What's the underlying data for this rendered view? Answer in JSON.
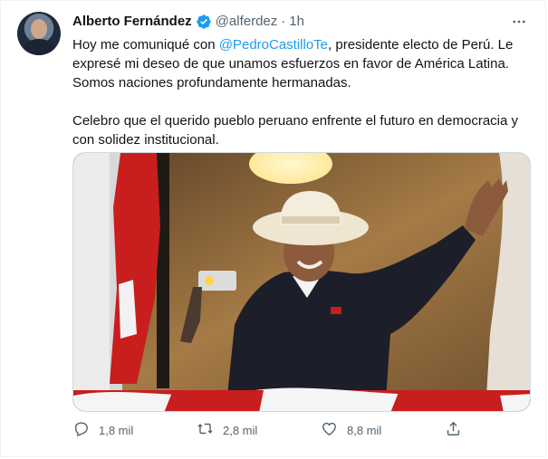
{
  "tweet": {
    "author_name": "Alberto Fernández",
    "author_handle": "@alferdez",
    "separator": "·",
    "time": "1h",
    "text_p1_before": "Hoy me comuniqué con ",
    "mention": "@PedroCastilloTe",
    "text_p1_after": ", presidente electo de Perú. Le expresé mi deseo de que unamos esfuerzos en favor de América Latina. Somos naciones profundamente hermanadas.",
    "text_p2": "Celebro que el querido pueblo peruano enfrente el futuro en democracia y con solidez institucional."
  },
  "actions": {
    "reply_count": "1,8 mil",
    "retweet_count": "2,8 mil",
    "like_count": "8,8 mil"
  },
  "icons": {
    "verified": "verified-badge-icon",
    "more": "more-icon",
    "reply": "reply-icon",
    "retweet": "retweet-icon",
    "like": "like-icon",
    "share": "share-icon"
  },
  "colors": {
    "link": "#1d9bf0",
    "secondary_text": "#536471",
    "primary_text": "#0f1419",
    "border": "#cfd9de"
  }
}
